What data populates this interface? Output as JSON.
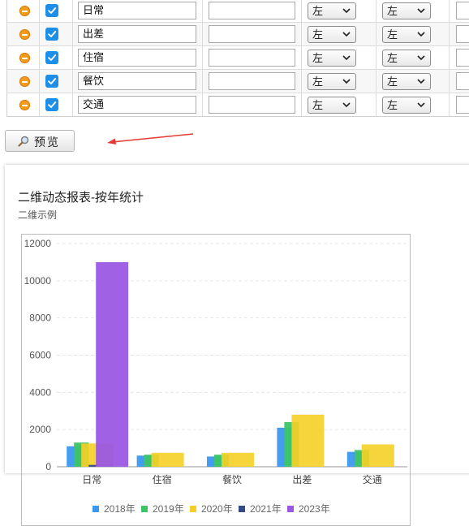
{
  "table": {
    "rows": [
      {
        "name": "日常",
        "align1": "左",
        "align2": "左"
      },
      {
        "name": "出差",
        "align1": "左",
        "align2": "左"
      },
      {
        "name": "住宿",
        "align1": "左",
        "align2": "左"
      },
      {
        "name": "餐饮",
        "align1": "左",
        "align2": "左"
      },
      {
        "name": "交通",
        "align1": "左",
        "align2": "左"
      }
    ]
  },
  "toolbar": {
    "preview_label": "预览"
  },
  "chart": {
    "title": "二维动态报表-按年统计",
    "subtitle": "二维示例"
  },
  "colors": {
    "accent": "#1e8fe8",
    "minus": "#f39a1f",
    "arrow": "#e53935"
  },
  "icons": {
    "remove": "minus-circle-icon",
    "check": "check-icon",
    "preview": "magnifier-icon",
    "dropdown": "chevron-down-icon"
  },
  "chart_data": {
    "type": "bar",
    "categories": [
      "日常",
      "住宿",
      "餐饮",
      "出差",
      "交通"
    ],
    "ylim": [
      0,
      12000
    ],
    "yticks": [
      0,
      2000,
      4000,
      6000,
      8000,
      10000,
      12000
    ],
    "grid": true,
    "legend_position": "bottom",
    "series": [
      {
        "name": "2018年",
        "color": "#3a98f0",
        "values": [
          1100,
          600,
          550,
          2100,
          800
        ]
      },
      {
        "name": "2019年",
        "color": "#3dc466",
        "values": [
          1300,
          650,
          650,
          2400,
          900
        ]
      },
      {
        "name": "2020年",
        "color": "#f5cf26",
        "values": [
          1250,
          750,
          750,
          2800,
          1200
        ]
      },
      {
        "name": "2021年",
        "color": "#344a86",
        "values": [
          100,
          0,
          0,
          0,
          0
        ]
      },
      {
        "name": "2023年",
        "color": "#9b59e3",
        "values": [
          11000,
          0,
          0,
          0,
          0
        ]
      }
    ]
  }
}
